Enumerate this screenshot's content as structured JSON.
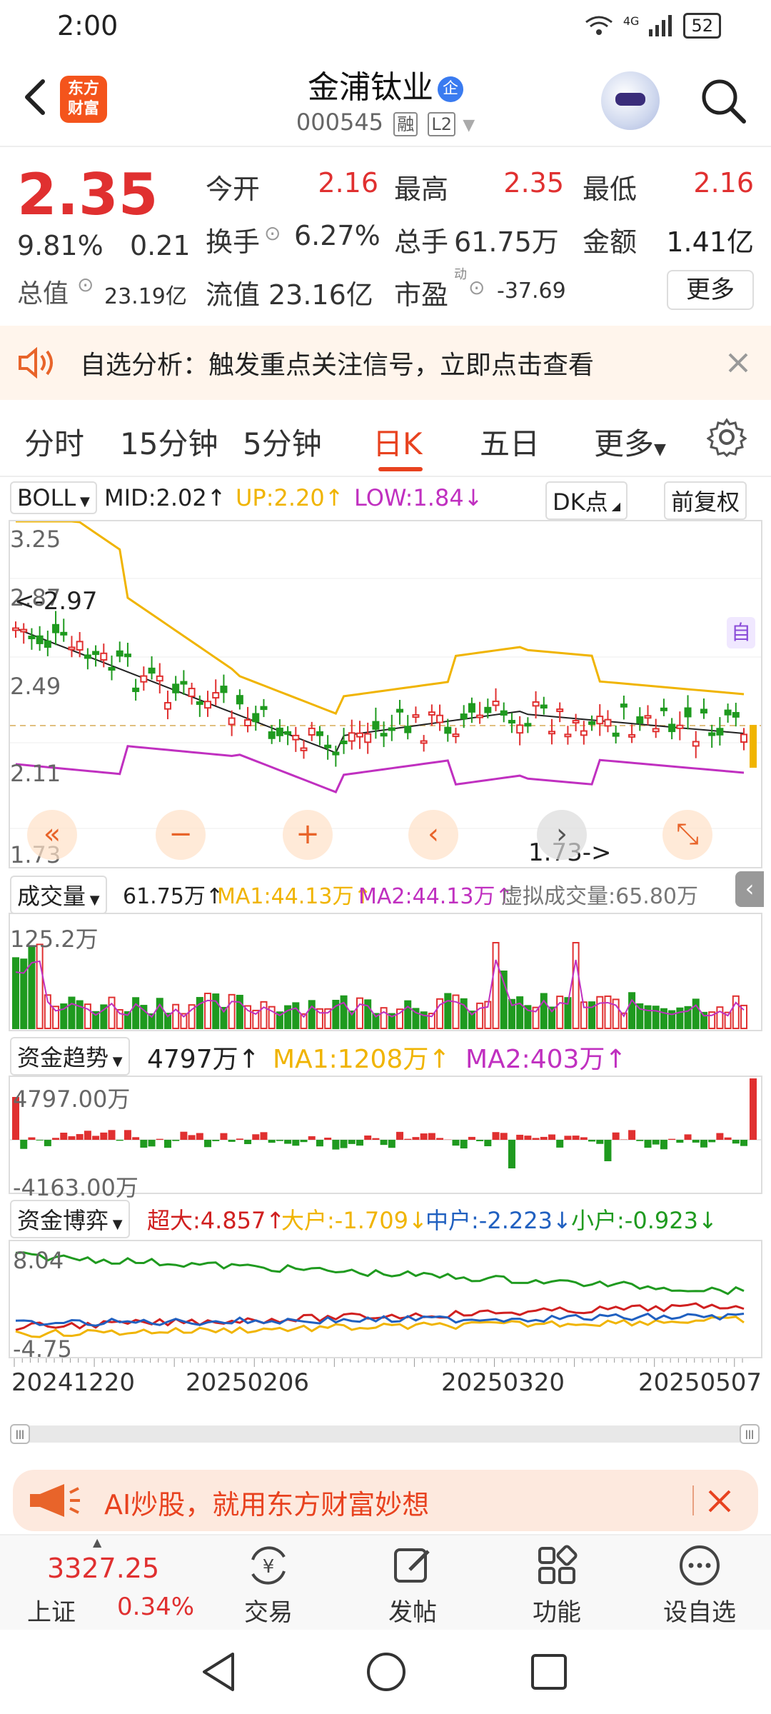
{
  "status_bar": {
    "time": "2:00",
    "network": "4G",
    "battery": "52"
  },
  "header": {
    "logo_line1": "东方",
    "logo_line2": "财富",
    "stock_name": "金浦钛业",
    "ent_badge": "企",
    "stock_code": "000545",
    "tag_margin": "融",
    "tag_level": "L2"
  },
  "quote": {
    "price": "2.35",
    "change_pct": "9.81%",
    "change_abs": "0.21",
    "open_label": "今开",
    "open": "2.16",
    "high_label": "最高",
    "high": "2.35",
    "low_label": "最低",
    "low": "2.16",
    "turnover_label": "换手",
    "turnover": "6.27%",
    "volume_label": "总手",
    "volume": "61.75万",
    "amount_label": "金额",
    "amount": "1.41亿",
    "mktcap_label": "总值",
    "mktcap": "23.19亿",
    "float_label": "流值",
    "float_cap": "23.16亿",
    "pe_label": "市盈",
    "pe_sup": "动",
    "pe": "-37.69",
    "more_label": "更多"
  },
  "banner1": {
    "text": "自选分析：触发重点关注信号，立即点击查看"
  },
  "tabs": [
    "分时",
    "15分钟",
    "5分钟",
    "日K",
    "五日",
    "更多"
  ],
  "boll": {
    "selector": "BOLL",
    "mid": "MID:2.02↑",
    "up": "UP:2.20↑",
    "low": "LOW:1.84↓",
    "dk": "DK点",
    "adjust": "前复权",
    "yticks": [
      "3.25",
      "2.87",
      "2.49",
      "2.11",
      "1.73"
    ],
    "high_mark": "<-2.97",
    "low_mark": "1.73->",
    "badge_zi": "自"
  },
  "volume": {
    "selector": "成交量",
    "value": "61.75万↑",
    "ma1": "MA1:44.13万↑",
    "ma2": "MA2:44.13万↑",
    "virtual": "虚拟成交量:65.80万",
    "max_label": "125.2万"
  },
  "fund_trend": {
    "selector": "资金趋势",
    "value": "4797万↑",
    "ma1": "MA1:1208万↑",
    "ma2": "MA2:403万↑",
    "max_label": "4797.00万",
    "min_label": "-4163.00万"
  },
  "fund_game": {
    "selector": "资金博弈",
    "super": "超大:4.857↑",
    "big": "大户:-1.709↓",
    "mid": "中户:-2.223↓",
    "small": "小户:-0.923↓",
    "max_label": "8.04",
    "min_label": "-4.75"
  },
  "dates": [
    "20241220",
    "20250206",
    "20250320",
    "20250507"
  ],
  "banner2": {
    "text": "AI炒股，就用东方财富妙想"
  },
  "bottom_nav": {
    "index_value": "3327.25",
    "index_name": "上证",
    "index_change": "0.34%",
    "items": [
      "交易",
      "发帖",
      "功能",
      "设自选"
    ]
  },
  "colors": {
    "up": "#e03030",
    "down": "#1f9a1f",
    "accent": "#e8421f",
    "yellow": "#f0b400",
    "magenta": "#c030c0"
  }
}
